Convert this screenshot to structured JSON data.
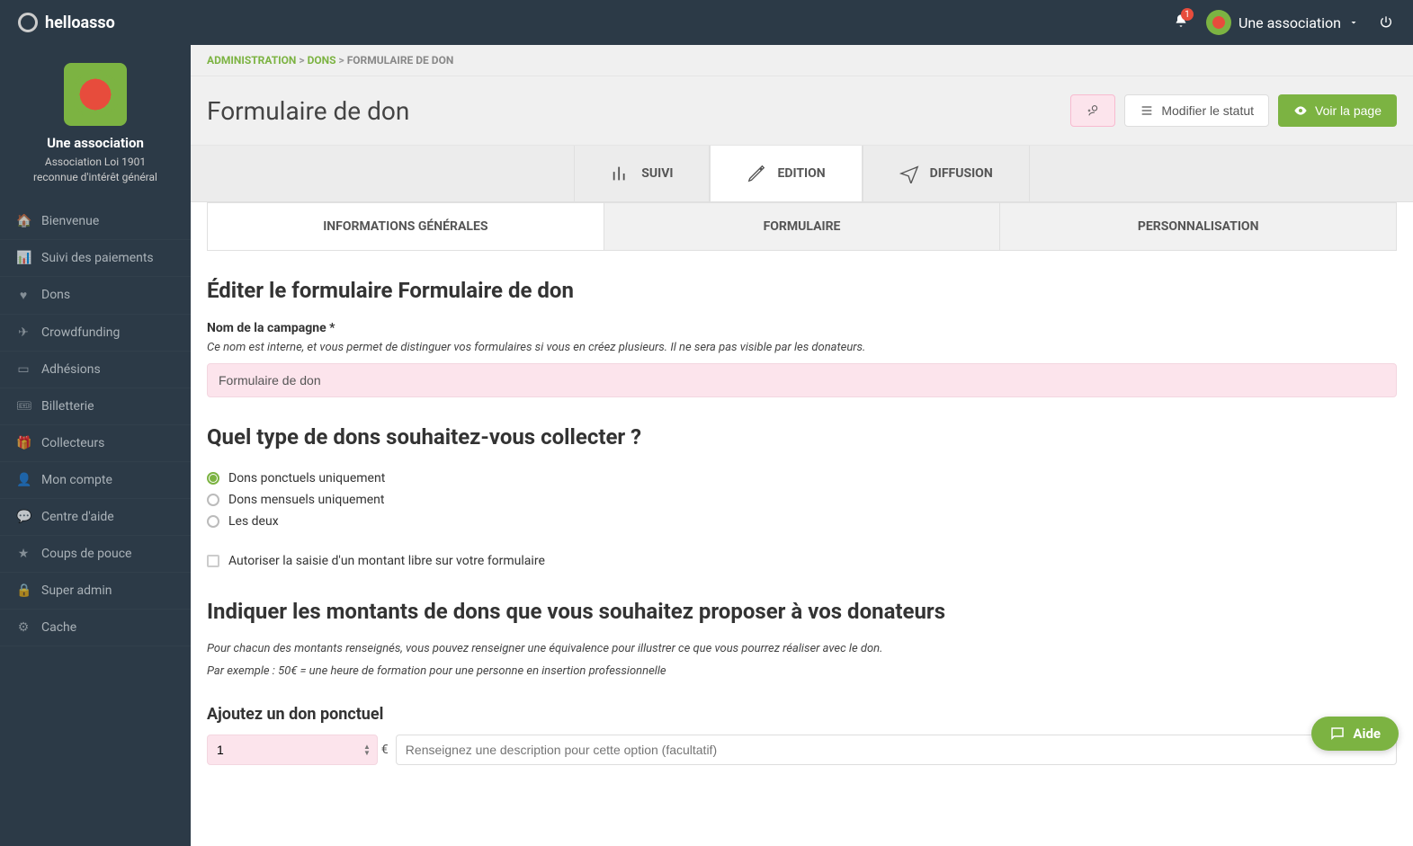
{
  "brand": "helloasso",
  "notifications": {
    "count": "1"
  },
  "user": {
    "name": "Une association"
  },
  "sidebar": {
    "org_name": "Une association",
    "org_sub1": "Association Loi 1901",
    "org_sub2": "reconnue d'intérêt général",
    "items": [
      {
        "label": "Bienvenue",
        "icon": "🏠"
      },
      {
        "label": "Suivi des paiements",
        "icon": "📊"
      },
      {
        "label": "Dons",
        "icon": "♥"
      },
      {
        "label": "Crowdfunding",
        "icon": "✈"
      },
      {
        "label": "Adhésions",
        "icon": "▭"
      },
      {
        "label": "Billetterie",
        "icon": "🎟"
      },
      {
        "label": "Collecteurs",
        "icon": "🎁"
      },
      {
        "label": "Mon compte",
        "icon": "👤"
      },
      {
        "label": "Centre d'aide",
        "icon": "💬"
      },
      {
        "label": "Coups de pouce",
        "icon": "★"
      },
      {
        "label": "Super admin",
        "icon": "🔒"
      },
      {
        "label": "Cache",
        "icon": "⚙"
      }
    ]
  },
  "breadcrumb": {
    "a": "ADMINISTRATION",
    "b": "DONS",
    "c": "FORMULAIRE DE DON"
  },
  "header": {
    "title": "Formulaire de don",
    "modify": "Modifier le statut",
    "view": "Voir la page"
  },
  "mode_tabs": {
    "suivi": "SUIVI",
    "edition": "EDITION",
    "diffusion": "DIFFUSION"
  },
  "sub_tabs": {
    "info": "INFORMATIONS GÉNÉRALES",
    "form": "FORMULAIRE",
    "perso": "PERSONNALISATION"
  },
  "section1": {
    "title": "Éditer le formulaire Formulaire de don",
    "label": "Nom de la campagne *",
    "hint": "Ce nom est interne, et vous permet de distinguer vos formulaires si vous en créez plusieurs. Il ne sera pas visible par les donateurs.",
    "value": "Formulaire de don"
  },
  "section2": {
    "title": "Quel type de dons souhaitez-vous collecter ?",
    "opt1": "Dons ponctuels uniquement",
    "opt2": "Dons mensuels uniquement",
    "opt3": "Les deux",
    "checkbox": "Autoriser la saisie d'un montant libre sur votre formulaire"
  },
  "section3": {
    "title": "Indiquer les montants de dons que vous souhaitez proposer à vos donateurs",
    "hint1": "Pour chacun des montants renseignés, vous pouvez renseigner une équivalence pour illustrer ce que vous pourrez réaliser avec le don.",
    "hint2": "Par exemple : 50€ = une heure de formation pour une personne en insertion professionnelle",
    "sub": "Ajoutez un don ponctuel",
    "amount": "1",
    "currency": "€",
    "placeholder": "Renseignez une description pour cette option (facultatif)"
  },
  "help": "Aide"
}
